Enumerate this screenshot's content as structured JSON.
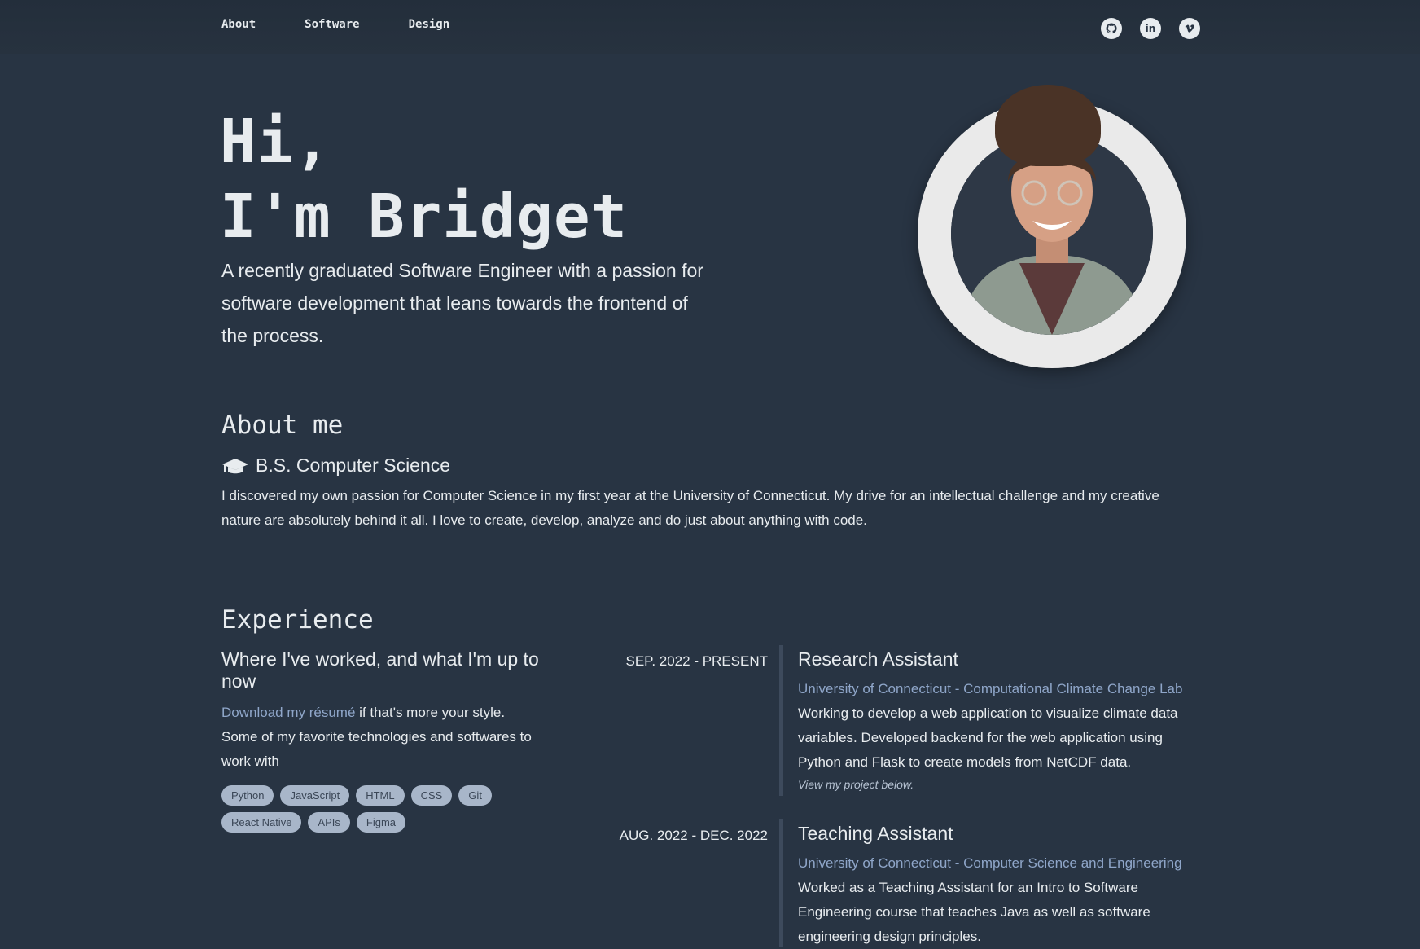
{
  "nav": {
    "items": [
      "About",
      "Software",
      "Design"
    ],
    "socials": [
      {
        "icon": "github-icon"
      },
      {
        "icon": "linkedin-icon"
      },
      {
        "icon": "vimeo-icon"
      }
    ]
  },
  "hero": {
    "greeting": "Hi,",
    "name": "I'm Bridget",
    "subtitle": "A recently graduated Software Engineer with a passion for software development that leans towards the frontend of the process."
  },
  "about": {
    "heading": "About me",
    "degree": "B.S. Computer Science",
    "text": "I discovered my own passion for Computer Science in my first year at the University of Connecticut. My drive for an intellectual challenge and my creative nature are absolutely behind it all. I love to create, develop, analyze and do just about anything with code."
  },
  "experience": {
    "heading": "Experience",
    "lead": "Where I've worked, and what I'm up to now",
    "resume_link": "Download my résumé",
    "resume_suffix": " if that's more your style.",
    "tech_intro": "Some of my favorite technologies and softwares to work with",
    "tags": [
      "Python",
      "JavaScript",
      "HTML",
      "CSS",
      "Git",
      "React Native",
      "APIs",
      "Figma"
    ],
    "jobs": [
      {
        "date": "SEP. 2022 - PRESENT",
        "title": "Research Assistant",
        "org": "University of Connecticut - Computational Climate Change Lab",
        "desc": "Working to develop a web application to visualize climate data variables. Developed backend for the web application using Python and Flask to create models from NetCDF data.",
        "note": "View my project below."
      },
      {
        "date": "AUG. 2022 - DEC. 2022",
        "title": "Teaching Assistant",
        "org": "University of Connecticut - Computer Science and Engineering",
        "desc": "Worked as a Teaching Assistant for an Intro to Software Engineering course that teaches Java as well as software engineering design principles."
      }
    ]
  },
  "colors": {
    "background": "#283443",
    "text": "#e8ecef",
    "link": "#8fa6c9",
    "tag_bg": "#a8b6c9"
  }
}
